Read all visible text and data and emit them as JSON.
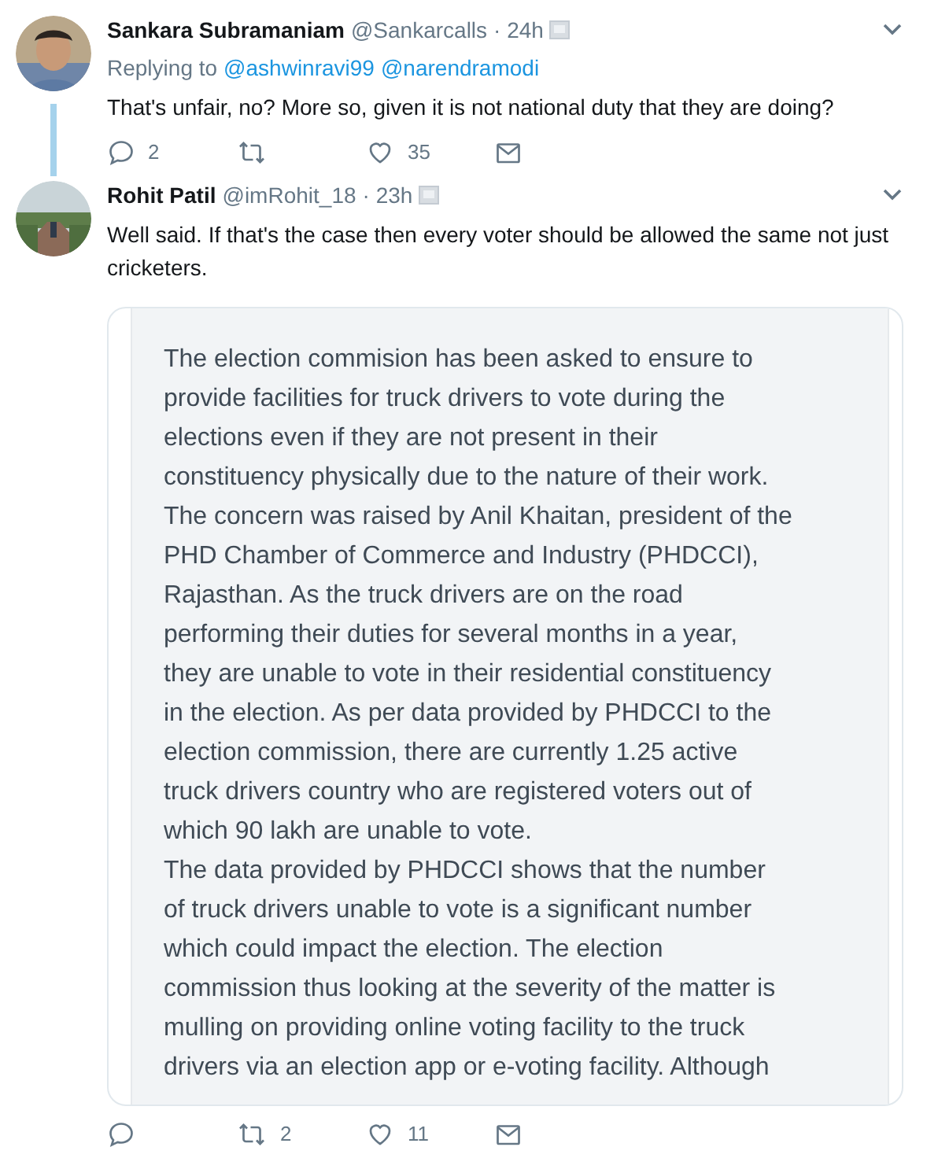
{
  "tweets": [
    {
      "name": "Sankara Subramaniam",
      "handle": "@Sankarcalls",
      "time": "· 24h",
      "replying_label": "Replying to",
      "mentions": [
        "@ashwinravi99",
        "@narendramodi"
      ],
      "text": [
        "That's unfair, no? More so, given it is not national duty that they are doing?"
      ],
      "actions": {
        "replies": "2",
        "likes": "35"
      },
      "thread_line": true
    },
    {
      "name": "Rohit Patil",
      "handle": "@imRohit_18",
      "time": "· 23h",
      "text": [
        "Well said. If that's the case then every voter should be allowed the same not just",
        "cricketers."
      ],
      "attachment": {
        "lines": [
          "The election commision has been asked to ensure to",
          "provide facilities for truck drivers to vote during the",
          "elections even if they are not present in their",
          "constituency physically due to the nature of their work.",
          "The concern was raised by Anil Khaitan, president of the",
          "PHD Chamber of Commerce and Industry (PHDCCI),",
          "Rajasthan. As the truck drivers are on the road",
          "performing their duties for several months in a year,",
          "they are unable to vote in their residential constituency",
          "in the election. As per data provided by PHDCCI to the",
          "election commission, there are currently 1.25 active",
          "truck drivers country who are registered voters out of",
          "which 90 lakh are unable to vote.",
          "The data provided by PHDCCI shows that the number",
          "of truck drivers unable to vote is a significant number",
          "which could impact the election. The election",
          "commission thus looking at the severity of the matter is",
          "mulling on providing online voting facility to the truck",
          "drivers via an election app or e-voting facility. Although"
        ]
      },
      "actions": {
        "retweets": "2",
        "likes": "11"
      },
      "thread_line": false
    }
  ]
}
